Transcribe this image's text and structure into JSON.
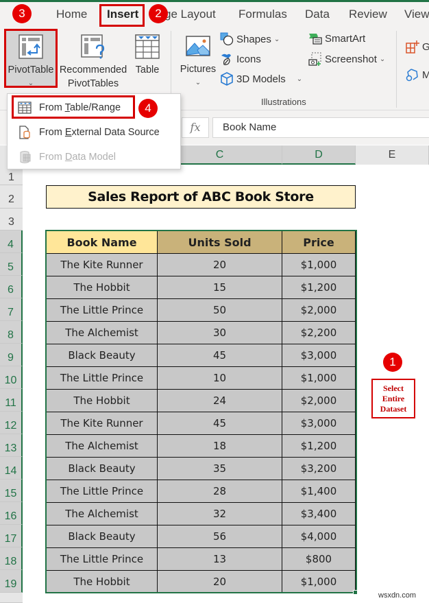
{
  "ribbon": {
    "tabs": [
      "Home",
      "Insert",
      "ge Layout",
      "Formulas",
      "Data",
      "Review",
      "View"
    ],
    "active_tab": "Insert",
    "buttons": {
      "pivottable": "PivotTable",
      "recommended_line1": "Recommended",
      "recommended_line2": "PivotTables",
      "table": "Table",
      "pictures": "Pictures",
      "shapes": "Shapes",
      "icons": "Icons",
      "models_3d": "3D Models",
      "smartart": "SmartArt",
      "screenshot": "Screenshot",
      "get_addins_partial": "G",
      "my_addins_partial": "M"
    },
    "group_label": "Illustrations"
  },
  "pivot_dropdown": {
    "items": [
      {
        "pre": "From ",
        "accel": "T",
        "post": "able/Range",
        "enabled": true
      },
      {
        "pre": "From ",
        "accel": "E",
        "post": "xternal Data Source",
        "enabled": true
      },
      {
        "pre": "From ",
        "accel": "D",
        "post": "ata Model",
        "enabled": false
      }
    ]
  },
  "formula_bar": {
    "fx_label": "fx",
    "value": "Book Name"
  },
  "columns": [
    "C",
    "D",
    "E"
  ],
  "rows": [
    "1",
    "2",
    "3",
    "4",
    "5",
    "6",
    "7",
    "8",
    "9",
    "10",
    "11",
    "12",
    "13",
    "14",
    "15",
    "16",
    "17",
    "18",
    "19"
  ],
  "sheet": {
    "title": "Sales Report of ABC Book Store",
    "headers": [
      "Book Name",
      "Units Sold",
      "Price"
    ],
    "data": [
      [
        "The Kite Runner",
        "20",
        "$1,000"
      ],
      [
        "The Hobbit",
        "15",
        "$1,200"
      ],
      [
        "The Little Prince",
        "50",
        "$2,000"
      ],
      [
        "The Alchemist",
        "30",
        "$2,200"
      ],
      [
        "Black Beauty",
        "45",
        "$3,000"
      ],
      [
        "The Little Prince",
        "10",
        "$1,000"
      ],
      [
        "The Hobbit",
        "24",
        "$2,000"
      ],
      [
        "The Kite Runner",
        "45",
        "$3,000"
      ],
      [
        "The Alchemist",
        "18",
        "$1,200"
      ],
      [
        "Black Beauty",
        "35",
        "$3,200"
      ],
      [
        "The Little Prince",
        "28",
        "$1,400"
      ],
      [
        "The Alchemist",
        "32",
        "$3,400"
      ],
      [
        "Black Beauty",
        "56",
        "$4,000"
      ],
      [
        "The Little Prince",
        "13",
        "$800"
      ],
      [
        "The Hobbit",
        "20",
        "$1,000"
      ]
    ]
  },
  "callouts": {
    "step1": "1",
    "step2": "2",
    "step3": "3",
    "step4": "4",
    "note_lines": [
      "Select",
      "Entire",
      "Dataset"
    ]
  },
  "watermark": "wsxdn.com",
  "colors": {
    "excel_green": "#217346",
    "callout_red": "#e60000",
    "header_gold": "#c9b27a",
    "header_yellow": "#ffe699",
    "title_fill": "#fff2cc",
    "cell_gray": "#c8c8c8"
  }
}
